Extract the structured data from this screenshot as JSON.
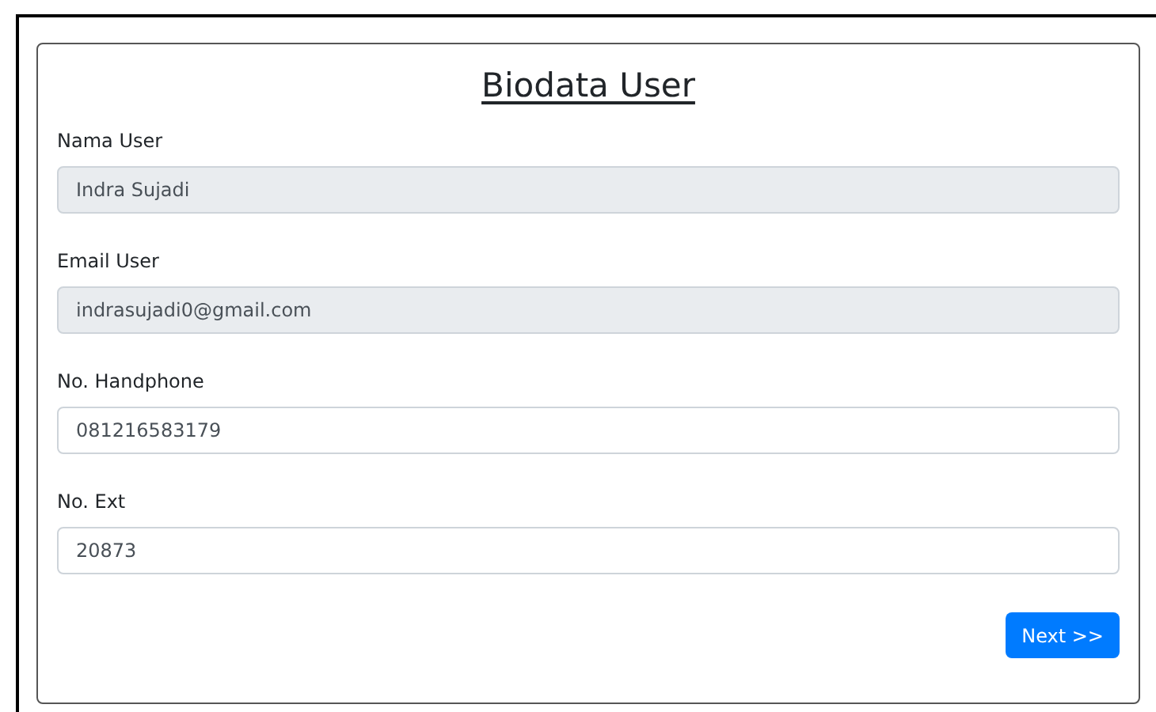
{
  "title": "Biodata User",
  "fields": [
    {
      "label": "Nama User",
      "value": "Indra Sujadi",
      "disabled": true
    },
    {
      "label": "Email User",
      "value": "indrasujadi0@gmail.com",
      "disabled": true
    },
    {
      "label": "No. Handphone",
      "value": "081216583179",
      "disabled": false
    },
    {
      "label": "No. Ext",
      "value": "20873",
      "disabled": false
    }
  ],
  "button": "Next >>"
}
